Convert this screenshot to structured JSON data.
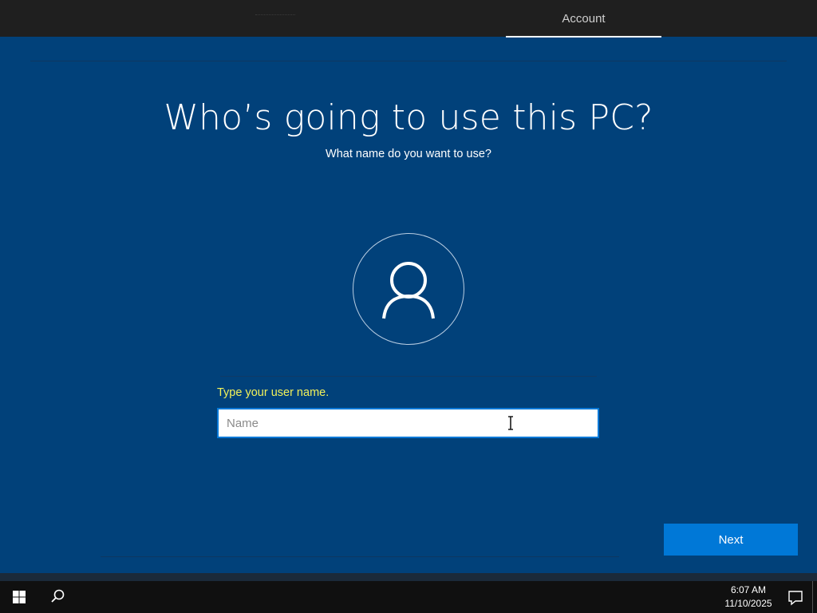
{
  "header": {
    "tabs": [
      {
        "label": "Account",
        "selected": true
      }
    ]
  },
  "main": {
    "title": "Who’s going to use this PC?",
    "subtitle": "What name do you want to use?",
    "avatar_icon": "user-icon",
    "name_field": {
      "label": "Type your user name.",
      "placeholder": "Name",
      "value": ""
    },
    "next_label": "Next"
  },
  "taskbar": {
    "start_icon": "windows-logo-icon",
    "search_icon": "search-icon",
    "time": "6:07 AM",
    "date": "11/10/2025",
    "notification_icon": "action-center-icon"
  },
  "colors": {
    "background": "#01417a",
    "accent": "#0078d7",
    "label": "#f1f15a",
    "topbar": "#1f1f1f",
    "taskbar": "#101010"
  }
}
